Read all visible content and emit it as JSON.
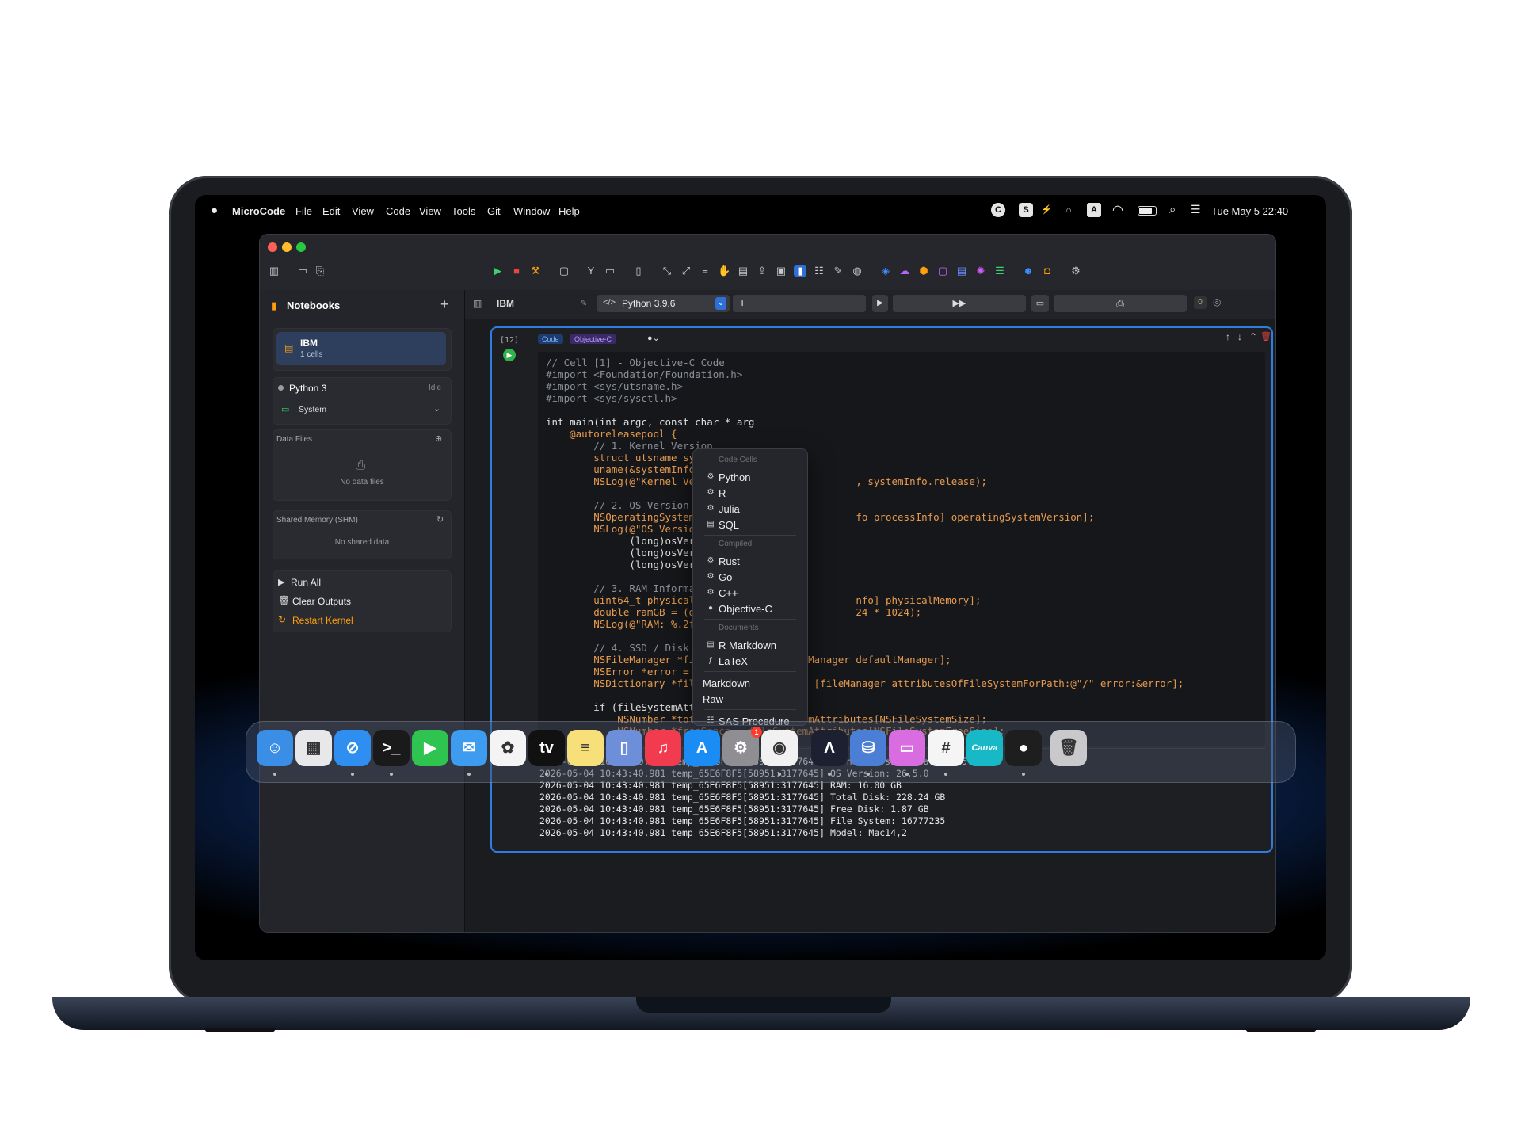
{
  "menubar": {
    "app": "MicroCode",
    "menus": [
      "File",
      "Edit",
      "View",
      "Code",
      "View",
      "Tools",
      "Git",
      "Window",
      "Help"
    ],
    "status_icons": [
      "C",
      "S",
      "⚡",
      "⌂",
      "A"
    ],
    "datetime": "Tue May 5  22:40"
  },
  "sidebar": {
    "title": "Notebooks",
    "notebook": {
      "name": "IBM",
      "cells": "1 cells"
    },
    "kernel": {
      "name": "Python 3",
      "status": "Idle",
      "env": "System"
    },
    "data_files": {
      "title": "Data Files",
      "empty": "No data files"
    },
    "shm": {
      "title": "Shared Memory (SHM)",
      "empty": "No shared data"
    },
    "actions": {
      "run_all": "Run All",
      "clear": "Clear Outputs",
      "restart": "Restart Kernel"
    }
  },
  "tabbar": {
    "tab": "IBM",
    "runtime": "Python 3.9.6",
    "add": "+",
    "count": "0"
  },
  "cell": {
    "exec": "[12]",
    "badge_code": "Code",
    "badge_lang": "Objective-C",
    "code_lines": [
      "// Cell [1] - Objective-C Code",
      "#import <Foundation/Foundation.h>",
      "#import <sys/utsname.h>",
      "#import <sys/sysctl.h>",
      "",
      "int main(int argc, const char * arg",
      "    @autoreleasepool {",
      "        // 1. Kernel Version",
      "        struct utsname systemInfo;",
      "        uname(&systemInfo);",
      "        NSLog(@\"Kernel Version: %s                  , systemInfo.release);",
      "",
      "        // 2. OS Version",
      "        NSOperatingSystemVersion os                 fo processInfo] operatingSystemVersion];",
      "        NSLog(@\"OS Version: %ld.%ld",
      "              (long)osVersion.major",
      "              (long)osVersion.minor",
      "              (long)osVersion.patch",
      "",
      "        // 3. RAM Information",
      "        uint64_t physicalMemory = [                 nfo] physicalMemory];",
      "        double ramGB = (double)phys                 24 * 1024);",
      "        NSLog(@\"RAM: %.2f GB\", ramG",
      "",
      "        // 4. SSD / Disk Informatio",
      "        NSFileManager *fileManager = [NSFileManager defaultManager];",
      "        NSError *error = nil;",
      "        NSDictionary *fileSystemAttributes = [fileManager attributesOfFileSystemForPath:@\"/\" error:&error];",
      "",
      "        if (fileSystemAttributes) {",
      "            NSNumber *totalSpace = fileSystemAttributes[NSFileSystemSize];",
      "            NSNumber *freeSpace = fileSystemAttributes[NSFileSystemFreeSize];"
    ],
    "output_lines": [
      "2026-05-04 10:43:40.976 temp_65E6F8F5[58951:3177645] Kernel Version: Darwin 25.5.0",
      "2026-05-04 10:43:40.981 temp_65E6F8F5[58951:3177645] OS Version: 26.5.0",
      "2026-05-04 10:43:40.981 temp_65E6F8F5[58951:3177645] RAM: 16.00 GB",
      "2026-05-04 10:43:40.981 temp_65E6F8F5[58951:3177645] Total Disk: 228.24 GB",
      "2026-05-04 10:43:40.981 temp_65E6F8F5[58951:3177645] Free Disk: 1.87 GB",
      "2026-05-04 10:43:40.981 temp_65E6F8F5[58951:3177645] File System: 16777235",
      "2026-05-04 10:43:40.981 temp_65E6F8F5[58951:3177645] Model: Mac14,2"
    ]
  },
  "dropdown": {
    "header_code": "Code Cells",
    "code": [
      "Python",
      "R",
      "Julia",
      "SQL"
    ],
    "header_compiled": "Compiled",
    "compiled": [
      "Rust",
      "Go",
      "C++",
      "Objective-C"
    ],
    "header_docs": "Documents",
    "docs": [
      "R Markdown",
      "LaTeX"
    ],
    "plain": [
      "Markdown",
      "Raw"
    ],
    "sas": "SAS Procedure"
  },
  "dock": {
    "apps": [
      {
        "name": "finder",
        "color": "#3a8ee6",
        "glyph": "☺"
      },
      {
        "name": "launchpad",
        "color": "#e8e8ea",
        "glyph": "▦"
      },
      {
        "name": "safari",
        "color": "#2f8ff0",
        "glyph": "⊘"
      },
      {
        "name": "terminal",
        "color": "#1a1a1a",
        "glyph": ">_"
      },
      {
        "name": "facetime",
        "color": "#2fc44f",
        "glyph": "▶"
      },
      {
        "name": "mail",
        "color": "#3d9bf0",
        "glyph": "✉"
      },
      {
        "name": "photos",
        "color": "#f4f4f4",
        "glyph": "✿"
      },
      {
        "name": "tv",
        "color": "#111111",
        "glyph": "tv"
      },
      {
        "name": "notes",
        "color": "#f7e07a",
        "glyph": "≡"
      },
      {
        "name": "simulator",
        "color": "#6d8ed8",
        "glyph": "▯"
      },
      {
        "name": "music",
        "color": "#f23b4f",
        "glyph": "♫"
      },
      {
        "name": "app-store",
        "color": "#1b8cf3",
        "glyph": "A"
      },
      {
        "name": "settings",
        "color": "#8e8e93",
        "glyph": "⚙"
      },
      {
        "name": "chrome",
        "color": "#f1f1f1",
        "glyph": "◉"
      },
      {
        "name": "microcode",
        "color": "#1c2030",
        "glyph": "Λ"
      },
      {
        "name": "storage",
        "color": "#4b7fd6",
        "glyph": "⛁"
      },
      {
        "name": "screens",
        "color": "#d86ce0",
        "glyph": "▭"
      },
      {
        "name": "slack",
        "color": "#f5f5f5",
        "glyph": "#"
      },
      {
        "name": "canva",
        "color": "#17b9c7",
        "glyph": "Canva"
      },
      {
        "name": "figma",
        "color": "#1e1e1e",
        "glyph": "●"
      },
      {
        "name": "trash",
        "color": "#c9c9cc",
        "glyph": "🗑"
      }
    ],
    "badges": {
      "settings": "1"
    }
  }
}
